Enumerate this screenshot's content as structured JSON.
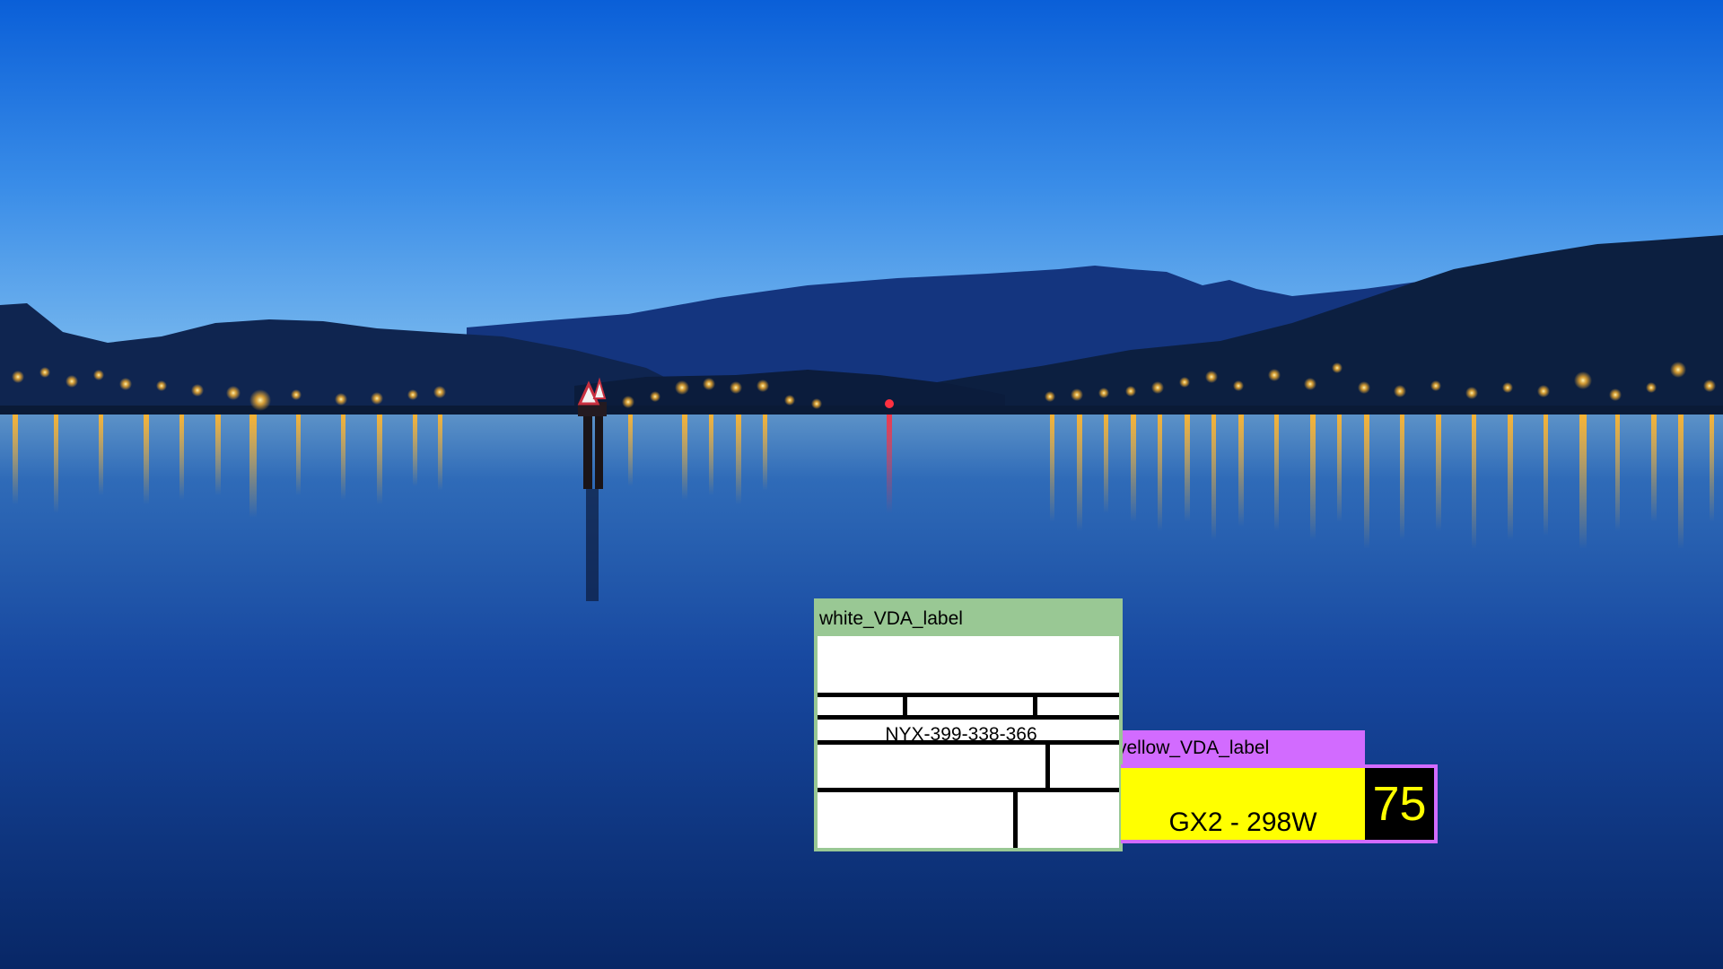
{
  "photo": {
    "subject": "lake-at-dusk-with-mountains-and-town-lights",
    "colors": {
      "sky_top": "#0a5fd8",
      "sky_horizon": "#86c3f0",
      "water_deep": "#0a2a70",
      "lights": "#ffb52e"
    }
  },
  "white_label": {
    "tag": "white_VDA_label",
    "code": "NYX-399-338-366",
    "color": "#99c894"
  },
  "yellow_label": {
    "tag": "yellow_VDA_label",
    "part": "GX2 - 298W",
    "number": "75",
    "color": "#d26bff"
  }
}
